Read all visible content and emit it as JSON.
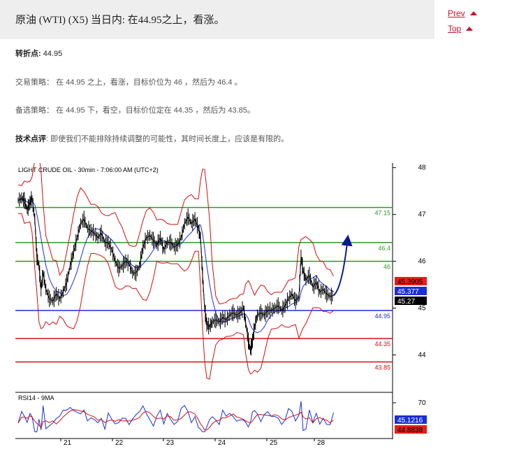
{
  "header": {
    "title": "原油 (WTI) (X5) 当日内: 在44.95之上，看涨。",
    "prev_label": "Prev",
    "top_label": "Top",
    "arrow_icon": "triangle-up-icon",
    "accent_color": "#c8102e"
  },
  "content": {
    "pivot_label": "转折点:",
    "pivot_value": "44.95",
    "strategy_label": "交易策略：",
    "strategy_text": "在 44.95 之上，看涨，目标价位为 46 ，然后为 46.4 。",
    "alt_label": "备选策略：",
    "alt_text": "在 44.95 下，看空，目标价位定在 44.35 ，然后为 43.85。",
    "comment_label": "技术点评",
    "comment_text": ": 即使我们不能排除持续调整的可能性，其时间长度上，应该是有限的。"
  },
  "chart_data": {
    "type": "candlestick",
    "title": "LIGHT CRUDE OIL - 30min - 7:06:00 AM (UTC+2)",
    "x_ticks": [
      "21",
      "22",
      "23",
      "24",
      "25",
      "28"
    ],
    "y_ticks": [
      44,
      45,
      46,
      47,
      48
    ],
    "ylim": [
      43.2,
      48.1
    ],
    "level_lines": [
      {
        "label": "47.15",
        "value": 47.15,
        "color": "#2a9a2a"
      },
      {
        "label": "46.4",
        "value": 46.4,
        "color": "#2a9a2a"
      },
      {
        "label": "46",
        "value": 46.0,
        "color": "#2a9a2a"
      },
      {
        "label": "44.95",
        "value": 44.95,
        "color": "#1a2fd8"
      },
      {
        "label": "44.35",
        "value": 44.35,
        "color": "#d01010"
      },
      {
        "label": "43.85",
        "value": 43.85,
        "color": "#d01010"
      }
    ],
    "price_series": [
      {
        "t": 0,
        "v": 47.3
      },
      {
        "t": 5,
        "v": 47.35
      },
      {
        "t": 9,
        "v": 47.3
      },
      {
        "t": 13,
        "v": 47.1
      },
      {
        "t": 17,
        "v": 47.25
      },
      {
        "t": 20,
        "v": 47.35
      },
      {
        "t": 24,
        "v": 46.9
      },
      {
        "t": 27,
        "v": 46.1
      },
      {
        "t": 30,
        "v": 45.9
      },
      {
        "t": 33,
        "v": 45.4
      },
      {
        "t": 36,
        "v": 45.75
      },
      {
        "t": 40,
        "v": 45.4
      },
      {
        "t": 45,
        "v": 45.2
      },
      {
        "t": 50,
        "v": 45.15
      },
      {
        "t": 55,
        "v": 45.3
      },
      {
        "t": 60,
        "v": 45.2
      },
      {
        "t": 65,
        "v": 45.35
      },
      {
        "t": 70,
        "v": 45.55
      },
      {
        "t": 75,
        "v": 45.9
      },
      {
        "t": 80,
        "v": 46.2
      },
      {
        "t": 85,
        "v": 46.5
      },
      {
        "t": 90,
        "v": 46.8
      },
      {
        "t": 95,
        "v": 46.9
      },
      {
        "t": 100,
        "v": 46.7
      },
      {
        "t": 105,
        "v": 46.65
      },
      {
        "t": 110,
        "v": 46.6
      },
      {
        "t": 115,
        "v": 46.5
      },
      {
        "t": 120,
        "v": 46.6
      },
      {
        "t": 125,
        "v": 46.4
      },
      {
        "t": 130,
        "v": 46.4
      },
      {
        "t": 135,
        "v": 46.25
      },
      {
        "t": 140,
        "v": 46.0
      },
      {
        "t": 145,
        "v": 45.85
      },
      {
        "t": 150,
        "v": 45.9
      },
      {
        "t": 155,
        "v": 46.0
      },
      {
        "t": 160,
        "v": 45.95
      },
      {
        "t": 165,
        "v": 45.75
      },
      {
        "t": 170,
        "v": 45.75
      },
      {
        "t": 175,
        "v": 45.9
      },
      {
        "t": 180,
        "v": 46.3
      },
      {
        "t": 185,
        "v": 46.5
      },
      {
        "t": 190,
        "v": 46.55
      },
      {
        "t": 195,
        "v": 46.45
      },
      {
        "t": 200,
        "v": 46.35
      },
      {
        "t": 205,
        "v": 46.5
      },
      {
        "t": 210,
        "v": 46.25
      },
      {
        "t": 215,
        "v": 46.4
      },
      {
        "t": 220,
        "v": 46.4
      },
      {
        "t": 225,
        "v": 46.3
      },
      {
        "t": 230,
        "v": 46.35
      },
      {
        "t": 235,
        "v": 46.5
      },
      {
        "t": 240,
        "v": 46.8
      },
      {
        "t": 245,
        "v": 46.95
      },
      {
        "t": 250,
        "v": 46.8
      },
      {
        "t": 255,
        "v": 46.9
      },
      {
        "t": 260,
        "v": 46.7
      },
      {
        "t": 263,
        "v": 46.5
      },
      {
        "t": 266,
        "v": 45.7
      },
      {
        "t": 269,
        "v": 45.0
      },
      {
        "t": 272,
        "v": 44.65
      },
      {
        "t": 276,
        "v": 44.6
      },
      {
        "t": 280,
        "v": 44.7
      },
      {
        "t": 285,
        "v": 44.75
      },
      {
        "t": 290,
        "v": 44.7
      },
      {
        "t": 295,
        "v": 44.8
      },
      {
        "t": 300,
        "v": 44.75
      },
      {
        "t": 305,
        "v": 44.85
      },
      {
        "t": 310,
        "v": 44.9
      },
      {
        "t": 315,
        "v": 44.85
      },
      {
        "t": 320,
        "v": 44.9
      },
      {
        "t": 325,
        "v": 45.0
      },
      {
        "t": 328,
        "v": 44.7
      },
      {
        "t": 332,
        "v": 44.3
      },
      {
        "t": 335,
        "v": 44.1
      },
      {
        "t": 338,
        "v": 44.3
      },
      {
        "t": 341,
        "v": 44.6
      },
      {
        "t": 345,
        "v": 44.85
      },
      {
        "t": 350,
        "v": 44.9
      },
      {
        "t": 355,
        "v": 44.85
      },
      {
        "t": 360,
        "v": 44.95
      },
      {
        "t": 365,
        "v": 44.95
      },
      {
        "t": 370,
        "v": 45.0
      },
      {
        "t": 375,
        "v": 45.05
      },
      {
        "t": 380,
        "v": 44.95
      },
      {
        "t": 385,
        "v": 45.05
      },
      {
        "t": 390,
        "v": 45.2
      },
      {
        "t": 395,
        "v": 45.3
      },
      {
        "t": 400,
        "v": 45.15
      },
      {
        "t": 405,
        "v": 45.25
      },
      {
        "t": 408,
        "v": 46.1
      },
      {
        "t": 411,
        "v": 45.8
      },
      {
        "t": 415,
        "v": 45.6
      },
      {
        "t": 420,
        "v": 45.7
      },
      {
        "t": 425,
        "v": 45.45
      },
      {
        "t": 430,
        "v": 45.55
      },
      {
        "t": 435,
        "v": 45.35
      },
      {
        "t": 440,
        "v": 45.4
      },
      {
        "t": 445,
        "v": 45.3
      },
      {
        "t": 450,
        "v": 45.25
      },
      {
        "t": 455,
        "v": 45.27
      }
    ],
    "projection": [
      {
        "t": 455,
        "v": 45.27
      },
      {
        "t": 475,
        "v": 46.45
      }
    ],
    "price_labels": [
      {
        "label": "45.3905",
        "value": 45.3905,
        "bg": "#e0201a",
        "fg": "#000000"
      },
      {
        "label": "45.377",
        "value": 45.377,
        "bg": "#1a2fd8",
        "fg": "#ffffff"
      },
      {
        "label": "45.27",
        "value": 45.27,
        "bg": "#000000",
        "fg": "#ffffff"
      }
    ],
    "rsi": {
      "title": "RSI14 - 9MA",
      "y_ticks": [
        70
      ],
      "labels": [
        {
          "label": "45.1216",
          "bg": "#1a2fd8",
          "fg": "#ffffff"
        },
        {
          "label": "44.8838",
          "bg": "#e0201a",
          "fg": "#000000"
        }
      ]
    },
    "colors": {
      "bollinger": "#d01010",
      "ma": "#1a2fd8",
      "bars": "#000000",
      "rsi_line": "#1a2fd8",
      "rsi_ma": "#d01010",
      "arrow": "#0a1a8a"
    }
  }
}
